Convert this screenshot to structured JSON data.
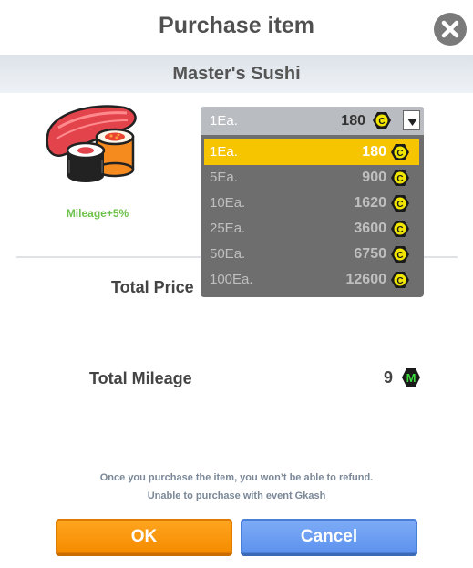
{
  "header": {
    "title": "Purchase item"
  },
  "item": {
    "name": "Master's Sushi",
    "mileage_bonus": "Mileage+5%"
  },
  "dropdown": {
    "selected_qty": "1Ea.",
    "selected_price": "180",
    "options": [
      {
        "qty": "1Ea.",
        "price": "180",
        "selected": true
      },
      {
        "qty": "5Ea.",
        "price": "900",
        "selected": false
      },
      {
        "qty": "10Ea.",
        "price": "1620",
        "selected": false
      },
      {
        "qty": "25Ea.",
        "price": "3600",
        "selected": false
      },
      {
        "qty": "50Ea.",
        "price": "6750",
        "selected": false
      },
      {
        "qty": "100Ea.",
        "price": "12600",
        "selected": false
      }
    ]
  },
  "summary": {
    "total_price_label": "Total Price",
    "total_mileage_label": "Total Mileage",
    "total_mileage_value": "9"
  },
  "notices": {
    "line1": "Once you purchase the item, you won’t be able to refund.",
    "line2": "Unable to purchase with event Gkash"
  },
  "buttons": {
    "ok": "OK",
    "cancel": "Cancel"
  },
  "icons": {
    "currency": "coin-c-icon",
    "mileage": "mileage-m-icon",
    "close": "close-icon",
    "dropdown": "chevron-down-icon"
  },
  "colors": {
    "accent_ok": "#f58d00",
    "accent_cancel": "#5f93ee",
    "dropdown_selected": "#f7c400",
    "mileage_green": "#6cc24a"
  }
}
